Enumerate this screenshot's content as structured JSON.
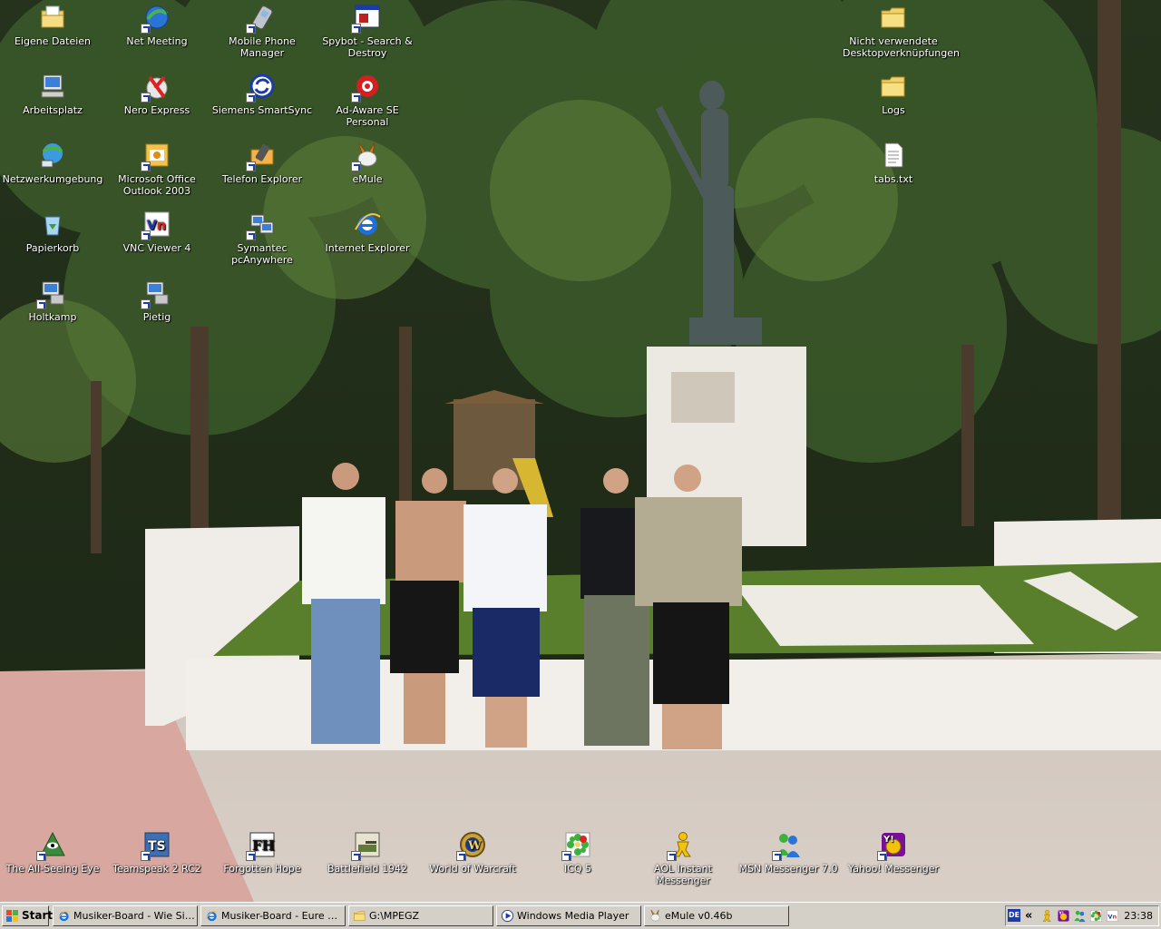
{
  "desktop": {
    "left_icons": [
      {
        "label": "Eigene Dateien",
        "icon": "my-documents-icon",
        "shortcut": false
      },
      {
        "label": "Net Meeting",
        "icon": "netmeeting-icon",
        "shortcut": true
      },
      {
        "label": "Mobile Phone Manager",
        "icon": "mobile-phone-icon",
        "shortcut": true
      },
      {
        "label": "Spybot - Search & Destroy",
        "icon": "spybot-icon",
        "shortcut": true
      },
      {
        "label": "Arbeitsplatz",
        "icon": "my-computer-icon",
        "shortcut": false
      },
      {
        "label": "Nero Express",
        "icon": "nero-icon",
        "shortcut": true
      },
      {
        "label": "Siemens SmartSync",
        "icon": "smartsync-icon",
        "shortcut": true
      },
      {
        "label": "Ad-Aware SE Personal",
        "icon": "adaware-icon",
        "shortcut": true
      },
      {
        "label": "Netzwerkumgebung",
        "icon": "network-icon",
        "shortcut": false
      },
      {
        "label": "Microsoft Office Outlook 2003",
        "icon": "outlook-icon",
        "shortcut": true
      },
      {
        "label": "Telefon Explorer",
        "icon": "phone-folder-icon",
        "shortcut": true
      },
      {
        "label": "eMule",
        "icon": "emule-icon",
        "shortcut": true
      },
      {
        "label": "Papierkorb",
        "icon": "recycle-bin-icon",
        "shortcut": false
      },
      {
        "label": "VNC Viewer 4",
        "icon": "vnc-icon",
        "shortcut": true
      },
      {
        "label": "Symantec pcAnywhere",
        "icon": "pcanywhere-icon",
        "shortcut": true
      },
      {
        "label": "Internet Explorer",
        "icon": "internet-explorer-icon",
        "shortcut": false
      },
      {
        "label": "Holtkamp",
        "icon": "remote-computer-icon",
        "shortcut": true
      },
      {
        "label": "Pietig",
        "icon": "remote-computer-icon",
        "shortcut": true
      }
    ],
    "right_icons": [
      {
        "label": "Nicht verwendete Desktopverknüpfungen",
        "icon": "folder-icon",
        "shortcut": false
      },
      {
        "label": "Logs",
        "icon": "folder-icon",
        "shortcut": false
      },
      {
        "label": "tabs.txt",
        "icon": "text-file-icon",
        "shortcut": false
      }
    ],
    "bottom_icons": [
      {
        "label": "The All-Seeing Eye",
        "icon": "all-seeing-eye-icon",
        "shortcut": true
      },
      {
        "label": "Teamspeak 2 RC2",
        "icon": "teamspeak-icon",
        "shortcut": true
      },
      {
        "label": "Forgotten Hope",
        "icon": "forgotten-hope-icon",
        "shortcut": true
      },
      {
        "label": "Battlefield 1942",
        "icon": "battlefield-icon",
        "shortcut": true
      },
      {
        "label": "World of Warcraft",
        "icon": "wow-icon",
        "shortcut": true
      },
      {
        "label": "ICQ 5",
        "icon": "icq-icon",
        "shortcut": true
      },
      {
        "label": "AOL Instant Messenger",
        "icon": "aim-icon",
        "shortcut": true
      },
      {
        "label": "MSN Messenger 7.0",
        "icon": "msn-icon",
        "shortcut": true
      },
      {
        "label": "Yahoo! Messenger",
        "icon": "yahoo-icon",
        "shortcut": true
      }
    ]
  },
  "taskbar": {
    "start_label": "Start",
    "tasks": [
      {
        "label": "Musiker-Board - Wie Sieh...",
        "icon": "internet-explorer-icon"
      },
      {
        "label": "Musiker-Board - Eure De...",
        "icon": "internet-explorer-icon"
      },
      {
        "label": "G:\\MPEGZ",
        "icon": "folder-icon"
      },
      {
        "label": "Windows Media Player",
        "icon": "media-player-icon"
      },
      {
        "label": "eMule v0.46b",
        "icon": "emule-icon"
      }
    ],
    "tray": {
      "language": "DE",
      "chevron": "«",
      "icons": [
        "aim-icon",
        "yahoo-icon",
        "msn-icon",
        "icq-icon",
        "vnc-icon"
      ],
      "clock": "23:38"
    }
  },
  "colors": {
    "taskbar": "#d4d0c8",
    "ie_blue": "#1e6fd9",
    "folder_yellow": "#f3d26b"
  }
}
